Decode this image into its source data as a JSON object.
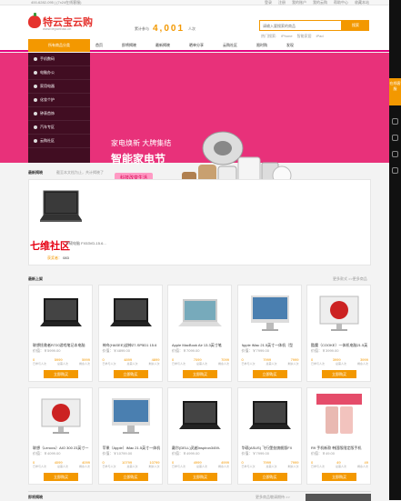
{
  "topbar": {
    "phone": "400-6282-095  |  (7x24在线客服)",
    "links": [
      "登录",
      "注册",
      "我的账户",
      "我的云购",
      "帮助中心",
      "收藏本站"
    ]
  },
  "logo": {
    "name": "特云宝云购",
    "domain": "www.teyunbao.cn"
  },
  "counter": {
    "label": "累计参与",
    "value": "4,001",
    "unit": "人次"
  },
  "search": {
    "placeholder": "请输入要搜索的商品",
    "button": "搜索",
    "hot": [
      "热门搜索:",
      "iPhone",
      "智能家居",
      "iPad"
    ]
  },
  "nav": {
    "category": "所有商品分类",
    "items": [
      "首页",
      "即将揭晓",
      "最新揭晓",
      "晒单分享",
      "云购社区",
      "限时购",
      "发现"
    ]
  },
  "sidebar": [
    "手机数码",
    "电脑办公",
    "家用电器",
    "化妆个护",
    "钟表首饰",
    "汽车专区",
    "云购社区"
  ],
  "banner": {
    "line1": "家电焕新  大牌集结",
    "line2": "智能家电节",
    "tag": "科技改变生活"
  },
  "rightbar": {
    "tab": "在线客服"
  },
  "latest": {
    "title": "最新揭晓",
    "sub": "截至本文档为止，共计揭晓了",
    "winner_label": "获奖者：",
    "winner_name": "083",
    "product": "华硕电脑 FX53VD-15.6...",
    "stamp": "七维社区"
  },
  "new": {
    "title": "最新上架",
    "more": "更多款式 >>更多商品"
  },
  "products": [
    {
      "name": "联想拯救者R720游戏笔记本电脑",
      "price": "价值：￥5999.00",
      "joined": "0",
      "total": "5999",
      "left": "5999"
    },
    {
      "name": "神舟(HASEE)战神Z7-SP5D1 15.6",
      "price": "价值：￥4899.00",
      "joined": "0",
      "total": "4899",
      "left": "4899"
    },
    {
      "name": "Apple MacBook Air 13.3英寸笔",
      "price": "价值：￥7099.00",
      "joined": "0",
      "total": "7099",
      "left": "7099"
    },
    {
      "name": "Apple iMac 21.5英寸一体机（型",
      "price": "价值：￥7999.00",
      "joined": "0",
      "total": "7999",
      "left": "7999"
    },
    {
      "name": "酷魔（COOKE）一体机电脑21.5英",
      "price": "价值：￥3999.00",
      "joined": "0",
      "total": "3999",
      "left": "3999"
    },
    {
      "name": "联想（Lenovo）AIO 300 23英寸一",
      "price": "价值：￥4099.00",
      "joined": "0",
      "total": "4099",
      "left": "4099"
    },
    {
      "name": "苹果（Apple）iMac 21.5英寸一体机",
      "price": "价值：￥10799.00",
      "joined": "0",
      "total": "10799",
      "left": "10799"
    },
    {
      "name": "戴尔(DELL)灵越Inspiron3459-",
      "price": "价值：￥4999.00",
      "joined": "0",
      "total": "4999",
      "left": "4999"
    },
    {
      "name": "华硕(ASUS) 飞行堡垒旗舰版FX",
      "price": "价值：￥7999.00",
      "joined": "0",
      "total": "7999",
      "left": "7999"
    },
    {
      "name": "R9 手机新款 韩国版限定版手机",
      "price": "价值：￥49.00",
      "joined": "0",
      "total": "49",
      "left": "49"
    }
  ],
  "stat_labels": [
    "已参与人次",
    "总需人次",
    "剩余人次"
  ],
  "buy_label": "立即购买",
  "bottom": {
    "title": "即将揭晓",
    "more": "更多商品敬请期待 >>"
  },
  "colors": {
    "accent": "#f39800",
    "banner": "#e8317a",
    "nav_line": "#e4007f"
  }
}
